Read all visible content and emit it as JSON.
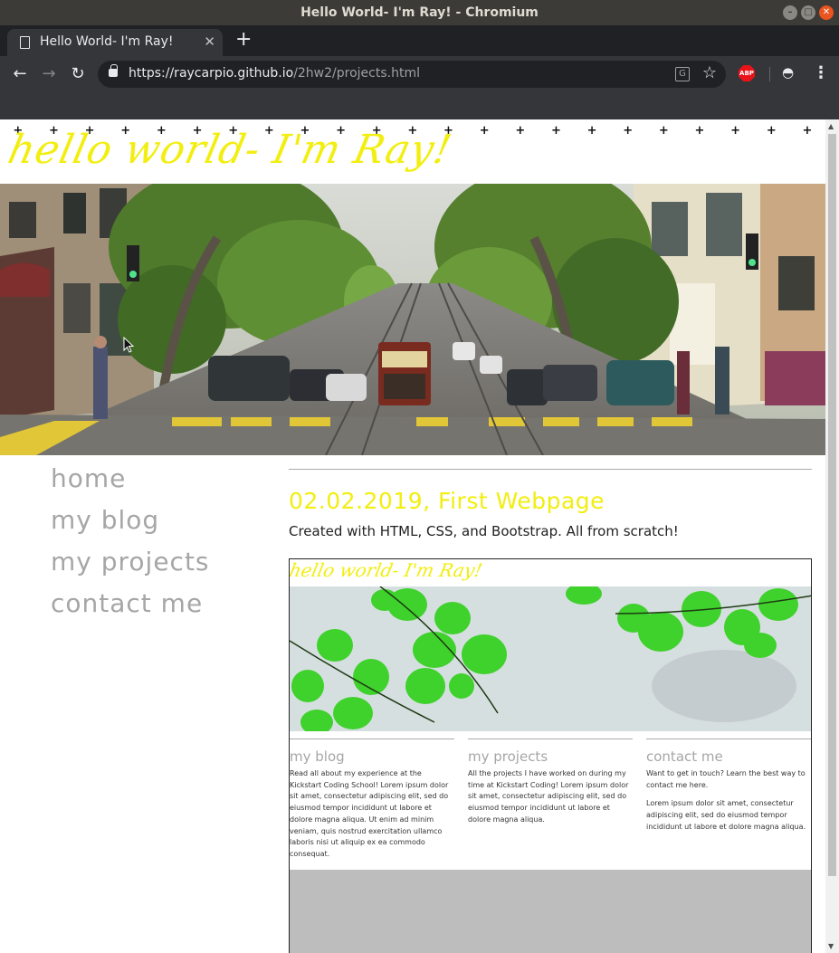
{
  "window": {
    "title": "Hello World- I'm Ray! - Chromium"
  },
  "tab": {
    "title": "Hello World- I'm Ray!"
  },
  "address_bar": {
    "host": "https://raycarpio.github.io",
    "path": "/2hw2/projects.html"
  },
  "site": {
    "title": "hello world- I'm Ray!"
  },
  "nav": {
    "items": [
      "home",
      "my blog",
      "my projects",
      "contact me"
    ]
  },
  "post": {
    "title": "02.02.2019, First Webpage",
    "description": "Created with HTML, CSS, and Bootstrap. All from scratch!"
  },
  "screenshot": {
    "title": "hello world- I'm Ray!",
    "columns": [
      {
        "heading": "my blog",
        "text": "Read all about my experience at the Kickstart Coding School! Lorem ipsum dolor sit amet, consectetur adipiscing elit, sed do eiusmod tempor incididunt ut labore et dolore magna aliqua. Ut enim ad minim veniam, quis nostrud exercitation ullamco laboris nisi ut aliquip ex ea commodo consequat."
      },
      {
        "heading": "my projects",
        "text": "All the projects I have worked on during my time at Kickstart Coding! Lorem ipsum dolor sit amet, consectetur adipiscing elit, sed do eiusmod tempor incididunt ut labore et dolore magna aliqua."
      },
      {
        "heading": "contact me",
        "text": "Want to get in touch? Learn the best way to contact me here.",
        "text2": "Lorem ipsum dolor sit amet, consectetur adipiscing elit, sed do eiusmod tempor incididunt ut labore et dolore magna aliqua."
      }
    ]
  },
  "colors": {
    "accent_yellow": "#f2ee10",
    "nav_gray": "#a6a6a6",
    "chrome_dark": "#35363a"
  }
}
